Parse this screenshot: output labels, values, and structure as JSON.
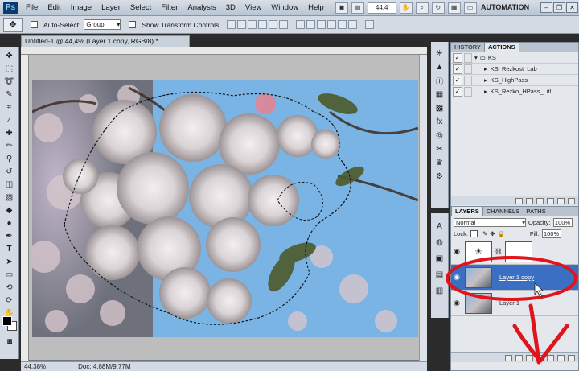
{
  "menubar": {
    "logo": "Ps",
    "items": [
      "File",
      "Edit",
      "Image",
      "Layer",
      "Select",
      "Filter",
      "Analysis",
      "3D",
      "View",
      "Window",
      "Help"
    ],
    "zoom_value": "44,4",
    "workspace": "AUTOMATION"
  },
  "options": {
    "auto_select_label": "Auto-Select:",
    "auto_select_value": "Group",
    "show_transform_label": "Show Transform Controls"
  },
  "document": {
    "tab_title": "Untitled-1 @ 44,4% (Layer 1 copy, RGB/8) *",
    "status_zoom": "44,38%",
    "status_doc": "Doc: 4,88M/9,77M"
  },
  "history_panel": {
    "tabs": [
      "HISTORY",
      "ACTIONS"
    ],
    "active_tab": "ACTIONS",
    "actions": [
      {
        "label": "KS",
        "type": "folder"
      },
      {
        "label": "KS_Rezkost_Lab",
        "type": "action"
      },
      {
        "label": "KS_HighPass",
        "type": "action"
      },
      {
        "label": "KS_Rezko_HPass_Litl",
        "type": "action"
      }
    ]
  },
  "layers_panel": {
    "tabs": [
      "LAYERS",
      "CHANNELS",
      "PATHS"
    ],
    "active_tab": "LAYERS",
    "blend_mode": "Normal",
    "opacity_label": "Opacity:",
    "opacity_value": "100%",
    "lock_label": "Lock:",
    "fill_label": "Fill:",
    "fill_value": "100%",
    "layers": [
      {
        "name": "",
        "type": "adjustment",
        "selected": false
      },
      {
        "name": "Layer 1 copy",
        "selected": true
      },
      {
        "name": "Layer 1",
        "selected": false
      }
    ]
  },
  "colors": {
    "selected_layer": "#3b6fc4",
    "annotation_red": "#e0141c",
    "sky": "#7ab4e4"
  }
}
